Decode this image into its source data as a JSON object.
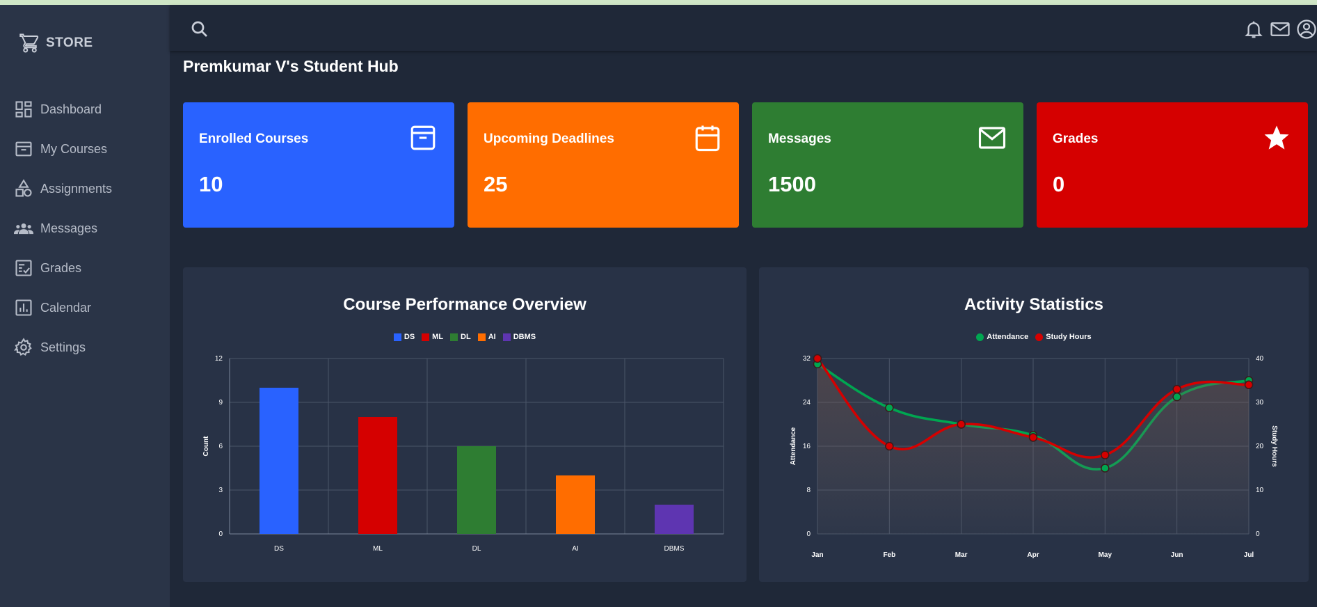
{
  "sidebar": {
    "brand": "STORE",
    "items": [
      {
        "label": "Dashboard",
        "icon": "dashboard-icon"
      },
      {
        "label": "My Courses",
        "icon": "archive-icon"
      },
      {
        "label": "Assignments",
        "icon": "shapes-icon"
      },
      {
        "label": "Messages",
        "icon": "people-icon"
      },
      {
        "label": "Grades",
        "icon": "grades-icon"
      },
      {
        "label": "Calendar",
        "icon": "bar-chart-icon"
      },
      {
        "label": "Settings",
        "icon": "gear-icon"
      }
    ]
  },
  "topbar": {
    "icons": [
      "search-icon",
      "bell-icon",
      "mail-icon",
      "account-icon"
    ]
  },
  "page": {
    "title": "Premkumar V's Student Hub"
  },
  "cards": [
    {
      "title": "Enrolled Courses",
      "value": "10",
      "color": "#2962ff",
      "icon": "archive-icon"
    },
    {
      "title": "Upcoming Deadlines",
      "value": "25",
      "color": "#ff6d00",
      "icon": "calendar-icon"
    },
    {
      "title": "Messages",
      "value": "1500",
      "color": "#2e7d32",
      "icon": "mail-icon"
    },
    {
      "title": "Grades",
      "value": "0",
      "color": "#d50000",
      "icon": "star-icon"
    }
  ],
  "chart_data": [
    {
      "type": "bar",
      "title": "Course Performance Overview",
      "categories": [
        "DS",
        "ML",
        "DL",
        "AI",
        "DBMS"
      ],
      "values": [
        10,
        8,
        6,
        4,
        2
      ],
      "colors": [
        "#2962ff",
        "#d50000",
        "#2e7d32",
        "#ff6d00",
        "#5e35b1"
      ],
      "legend": [
        "DS",
        "ML",
        "DL",
        "AI",
        "DBMS"
      ],
      "legend_position": "top",
      "ylabel": "Count",
      "ylim": [
        0,
        12
      ],
      "yticks": [
        "0",
        "3",
        "6",
        "9",
        "12"
      ],
      "grid": true
    },
    {
      "type": "line",
      "title": "Activity Statistics",
      "x": [
        "Jan",
        "Feb",
        "Mar",
        "Apr",
        "May",
        "Jun",
        "Jul"
      ],
      "series": [
        {
          "name": "Attendance",
          "color": "#00a651",
          "values": [
            31,
            23,
            20,
            18,
            12,
            25,
            28
          ],
          "axis": "left"
        },
        {
          "name": "Study Hours",
          "color": "#d50000",
          "values": [
            40,
            20,
            25,
            22,
            18,
            33,
            34
          ],
          "axis": "right"
        }
      ],
      "legend_position": "top",
      "ylabel": "Attendance",
      "ylabel_right": "Study Hours",
      "ylim": [
        0,
        32
      ],
      "ylim_right": [
        0,
        40
      ],
      "yticks": [
        "0",
        "8",
        "16",
        "24",
        "32"
      ],
      "yticks_right": [
        "0",
        "10",
        "20",
        "30",
        "40"
      ],
      "grid": true,
      "area_fill": true
    }
  ]
}
